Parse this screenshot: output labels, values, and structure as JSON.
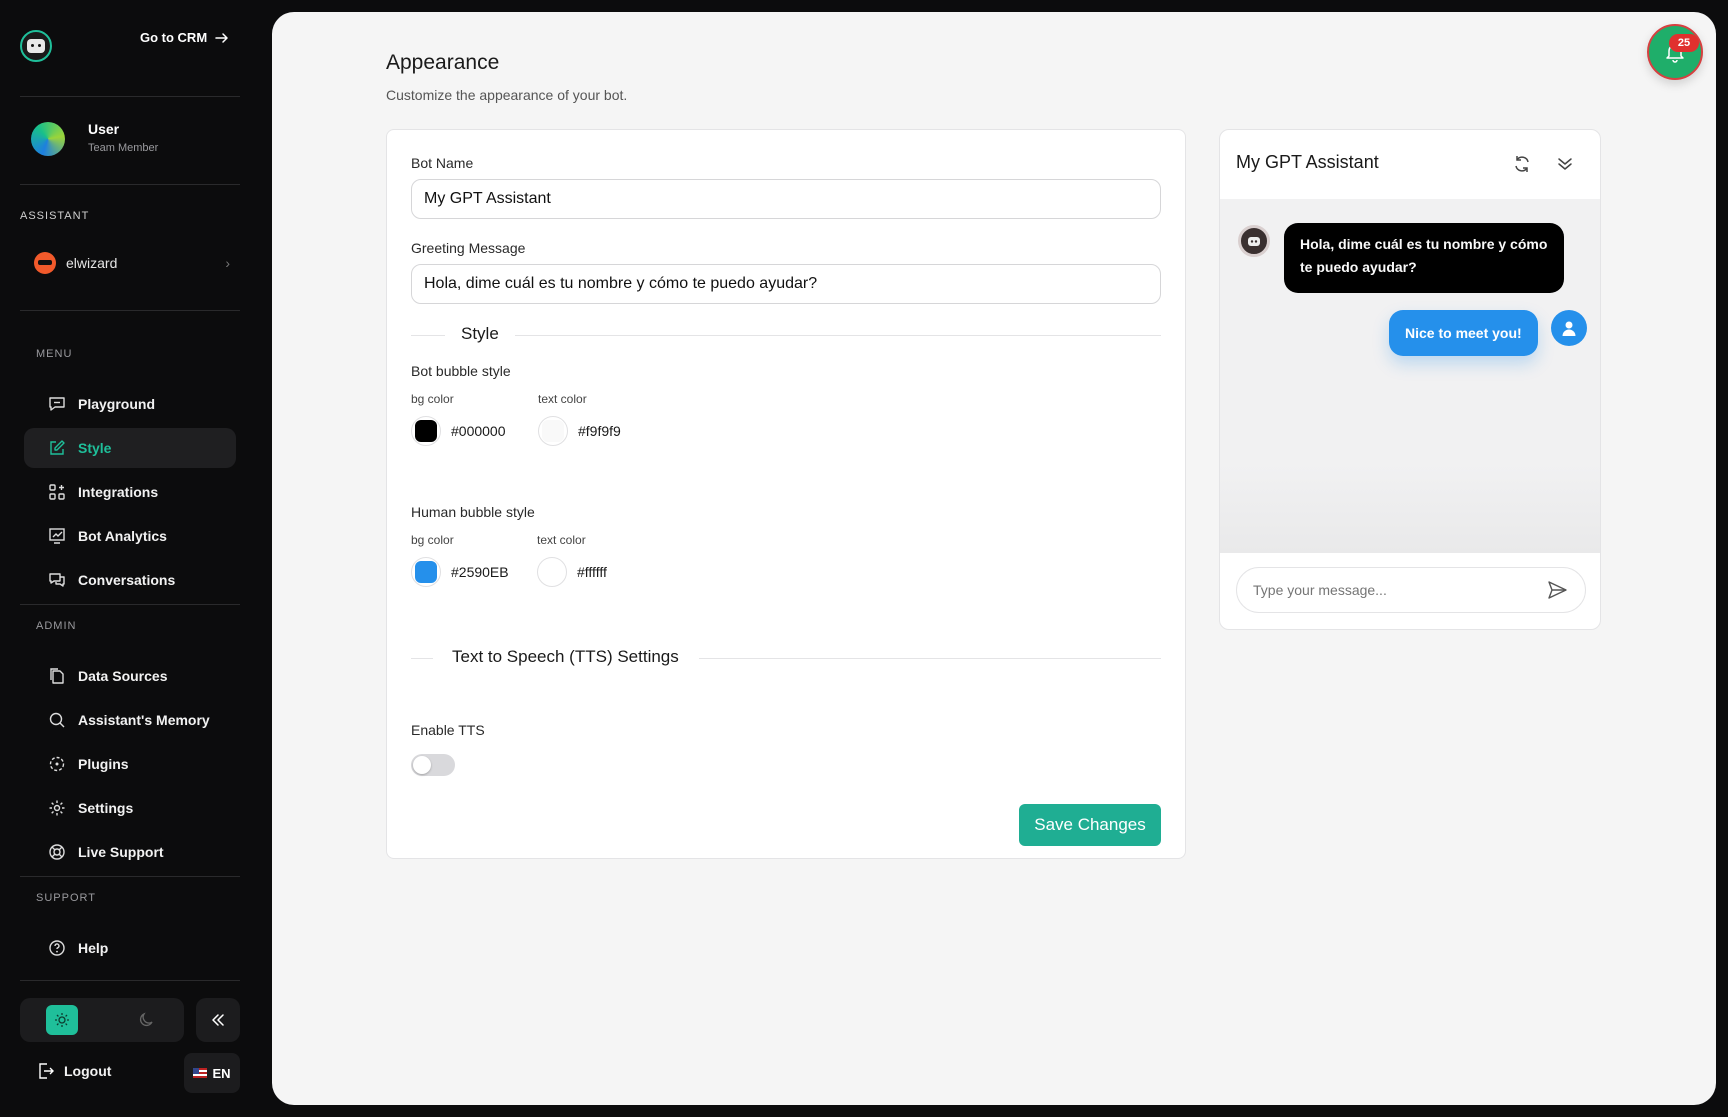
{
  "sidebar": {
    "go_to_crm": "Go to CRM",
    "user": {
      "name": "User",
      "role": "Team Member"
    },
    "assistant_section": "ASSISTANT",
    "assistant_name": "elwizard",
    "menu_section": "MENU",
    "menu_items": [
      {
        "label": "Playground",
        "icon": "chat-bubble-icon"
      },
      {
        "label": "Style",
        "icon": "pencil-square-icon",
        "active": true
      },
      {
        "label": "Integrations",
        "icon": "grid-plus-icon"
      },
      {
        "label": "Bot Analytics",
        "icon": "chart-icon"
      },
      {
        "label": "Conversations",
        "icon": "chat-bubbles-icon"
      }
    ],
    "admin_section": "ADMIN",
    "admin_items": [
      {
        "label": "Data Sources",
        "icon": "files-icon"
      },
      {
        "label": "Assistant's Memory",
        "icon": "search-icon"
      },
      {
        "label": "Plugins",
        "icon": "plugin-icon"
      },
      {
        "label": "Settings",
        "icon": "gear-icon"
      },
      {
        "label": "Live Support",
        "icon": "lifebuoy-icon"
      }
    ],
    "support_section": "SUPPORT",
    "support_items": [
      {
        "label": "Help",
        "icon": "question-circle-icon"
      }
    ],
    "logout": "Logout",
    "language": "EN",
    "theme": "light"
  },
  "page": {
    "title": "Appearance",
    "subtitle": "Customize the appearance of your bot."
  },
  "form": {
    "bot_name_label": "Bot Name",
    "bot_name_value": "My GPT Assistant",
    "greeting_label": "Greeting Message",
    "greeting_value": "Hola, dime cuál es tu nombre y cómo te puedo ayudar?",
    "style_section": "Style",
    "bot_bubble_label": "Bot bubble style",
    "bot_bubble": {
      "bg_label": "bg color",
      "bg": "#000000",
      "text_label": "text color",
      "text": "#f9f9f9"
    },
    "human_bubble_label": "Human bubble style",
    "human_bubble": {
      "bg_label": "bg color",
      "bg": "#2590EB",
      "text_label": "text color",
      "text": "#ffffff"
    },
    "tts_section": "Text to Speech (TTS) Settings",
    "tts_label": "Enable TTS",
    "tts_enabled": false,
    "save_label": "Save Changes"
  },
  "preview": {
    "title": "My GPT Assistant",
    "bot_message": "Hola, dime cuál es tu nombre y cómo te puedo ayudar?",
    "human_message": "Nice to meet you!",
    "input_placeholder": "Type your message..."
  },
  "notifications": {
    "count": "25"
  },
  "colors": {
    "accent": "#1fae93",
    "sidebar_bg": "#0c0c0d",
    "main_bg": "#f5f5f5"
  }
}
